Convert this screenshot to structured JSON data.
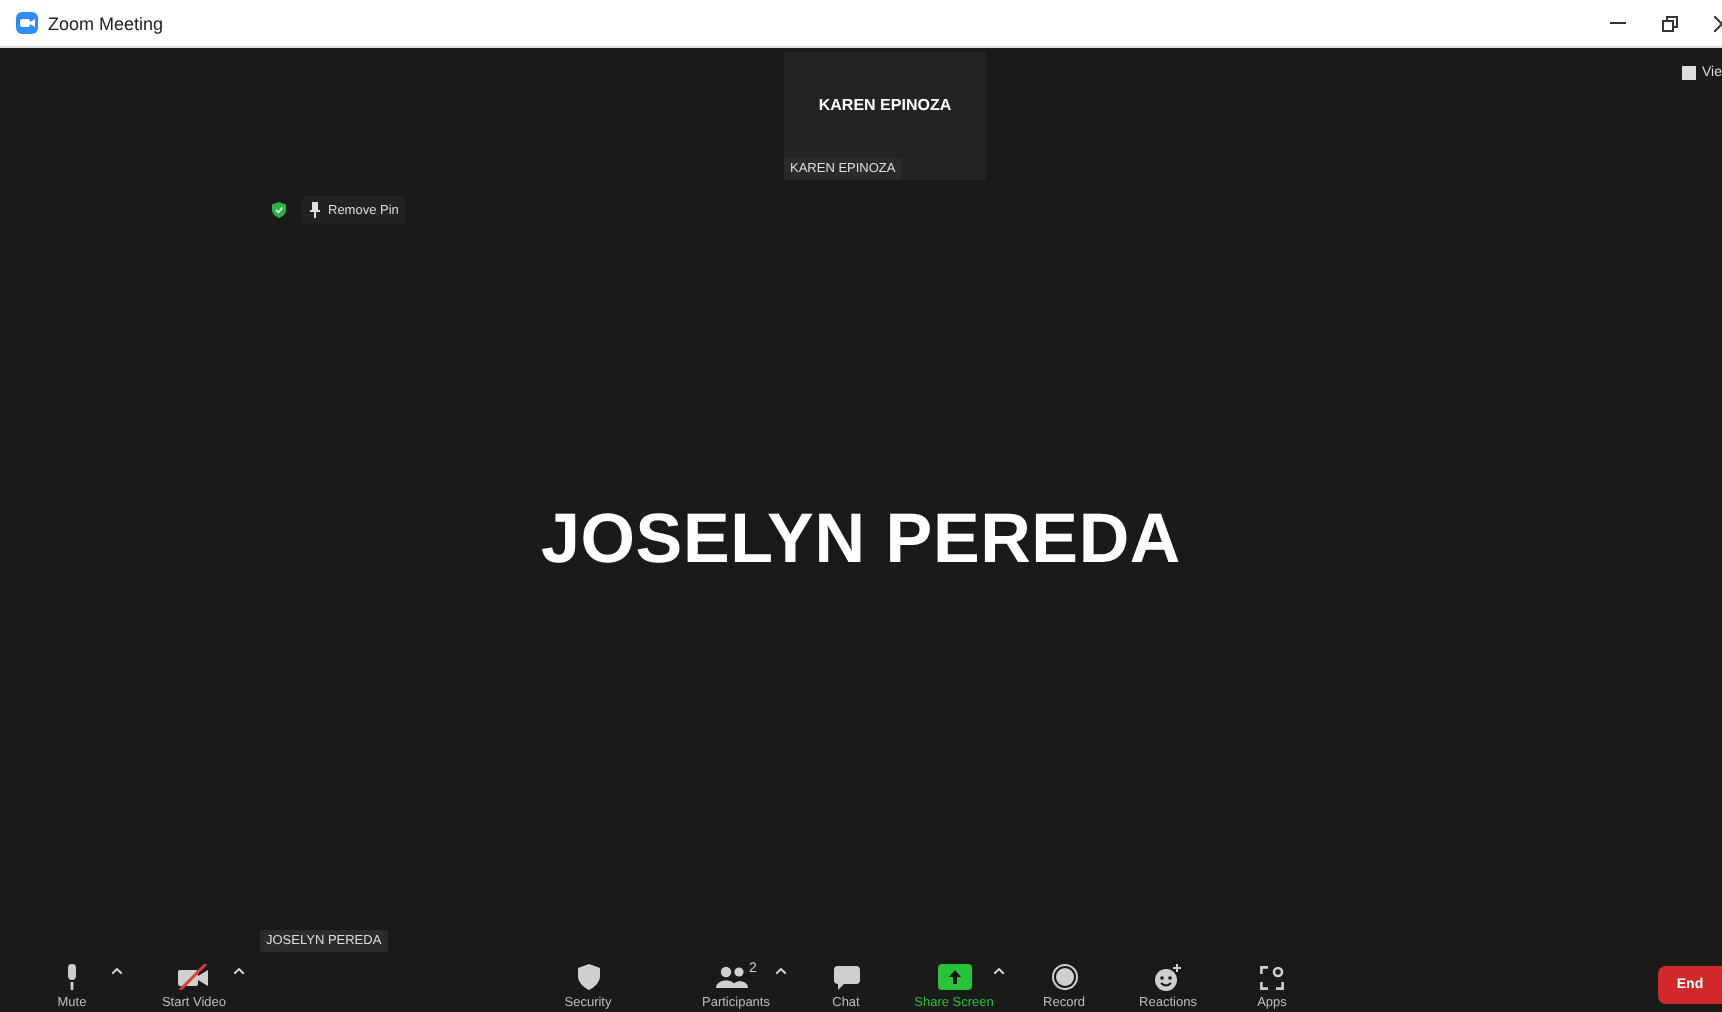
{
  "window": {
    "title": "Zoom Meeting"
  },
  "view_button": {
    "label": "Vie"
  },
  "thumbnail": {
    "name": "KAREN EPINOZA",
    "label": "KAREN EPINOZA"
  },
  "pin_bar": {
    "label": "Remove Pin"
  },
  "speaker": {
    "name": "JOSELYN PEREDA",
    "label": "JOSELYN PEREDA"
  },
  "toolbar": [
    {
      "kind": "mute",
      "label": "Mute",
      "caret": true,
      "highlighted": false
    },
    {
      "kind": "video",
      "label": "Start Video",
      "caret": true,
      "highlighted": false
    },
    {
      "kind": "security",
      "label": "Security",
      "caret": false,
      "highlighted": false
    },
    {
      "kind": "participants",
      "label": "Participants",
      "count": "2",
      "caret": true,
      "highlighted": false
    },
    {
      "kind": "chat",
      "label": "Chat",
      "caret": false,
      "highlighted": false
    },
    {
      "kind": "share",
      "label": "Share Screen",
      "caret": true,
      "highlighted": true
    },
    {
      "kind": "record",
      "label": "Record",
      "caret": false,
      "highlighted": false
    },
    {
      "kind": "reactions",
      "label": "Reactions",
      "caret": false,
      "highlighted": false
    },
    {
      "kind": "apps",
      "label": "Apps",
      "caret": false,
      "highlighted": false
    }
  ],
  "end_button": {
    "label": "End"
  }
}
